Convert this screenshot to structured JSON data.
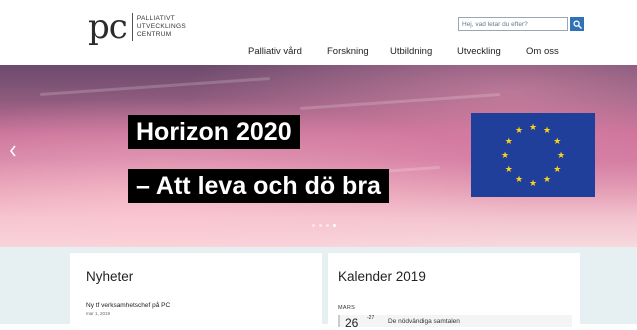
{
  "header": {
    "logo": {
      "mark": "pc",
      "lines": [
        "PALLIATIVT",
        "UTVECKLINGS",
        "CENTRUM"
      ]
    },
    "search": {
      "placeholder": "Hej, vad letar du efter?",
      "icon": "search-icon"
    },
    "nav": [
      {
        "label": "Palliativ vård"
      },
      {
        "label": "Forskning"
      },
      {
        "label": "Utbildning"
      },
      {
        "label": "Utveckling"
      },
      {
        "label": "Om oss"
      }
    ]
  },
  "hero": {
    "line1": "Horizon 2020",
    "line2": "– Att leva och dö bra",
    "prev_icon": "chevron-left-icon",
    "slide_count": 4,
    "active_slide": 4,
    "flag": {
      "icon": "eu-flag-icon",
      "background": "#1f3f9a",
      "star_color": "#ffd21a",
      "stars": 12
    }
  },
  "news": {
    "title": "Nyheter",
    "items": [
      {
        "title": "Ny tf verksamhetschef på PC",
        "date": "mar 1, 2019"
      }
    ]
  },
  "calendar": {
    "title": "Kalender 2019",
    "month": "MARS",
    "events": [
      {
        "day": "26",
        "sup": "-27",
        "title": "De nödvändiga samtalen"
      }
    ]
  },
  "colors": {
    "accent": "#2f72b5",
    "lower_background": "#e6eff2"
  }
}
